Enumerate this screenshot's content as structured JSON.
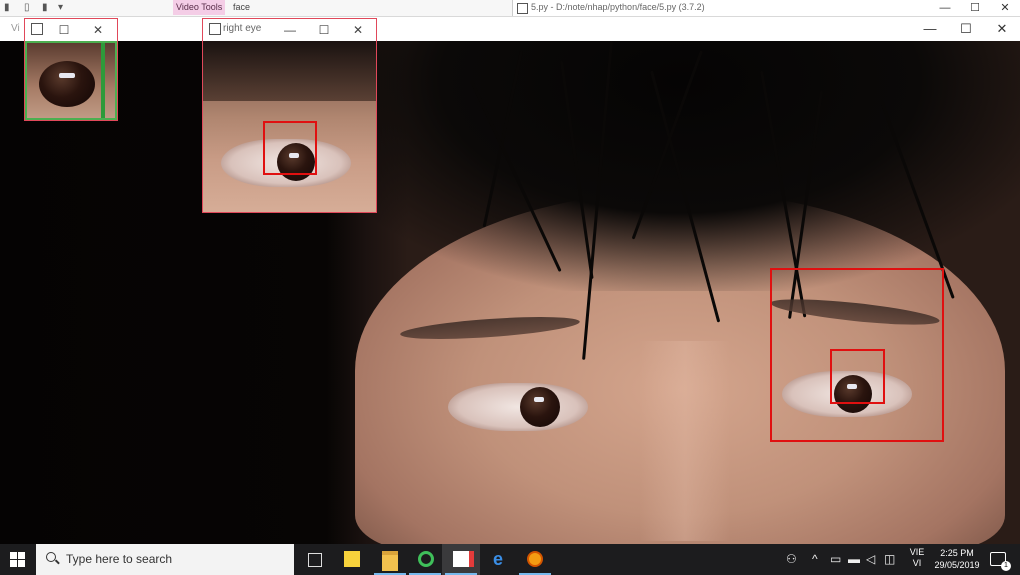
{
  "background": {
    "ribbon_tab_video_tools": "Video Tools",
    "ribbon_tab_face": "face",
    "python_window_title": "5.py - D:/note/nhap/python/face/5.py (3.7.2)"
  },
  "main_window": {
    "title": "",
    "minimize": "—",
    "maximize": "☐",
    "close": "✕"
  },
  "view_window": {
    "title": "Vi",
    "maximize": "☐",
    "close": "✕"
  },
  "right_eye_window": {
    "title": "right eye",
    "minimize": "—",
    "maximize": "☐",
    "close": "✕"
  },
  "colors": {
    "detection_box": "#e01010",
    "video_tools_accent": "#f4cde6",
    "taskbar": "#1c1c1e"
  },
  "taskbar": {
    "search_placeholder": "Type here to search",
    "apps": [
      {
        "name": "task-view-icon"
      },
      {
        "name": "sticky-notes-icon"
      },
      {
        "name": "file-explorer-icon"
      },
      {
        "name": "green-app-icon"
      },
      {
        "name": "paint-icon"
      },
      {
        "name": "edge-icon"
      },
      {
        "name": "orange-app-icon"
      }
    ],
    "lang_top": "VIE",
    "lang_bottom": "VI",
    "time": "2:25 PM",
    "date": "29/05/2019",
    "notifications": "1"
  }
}
